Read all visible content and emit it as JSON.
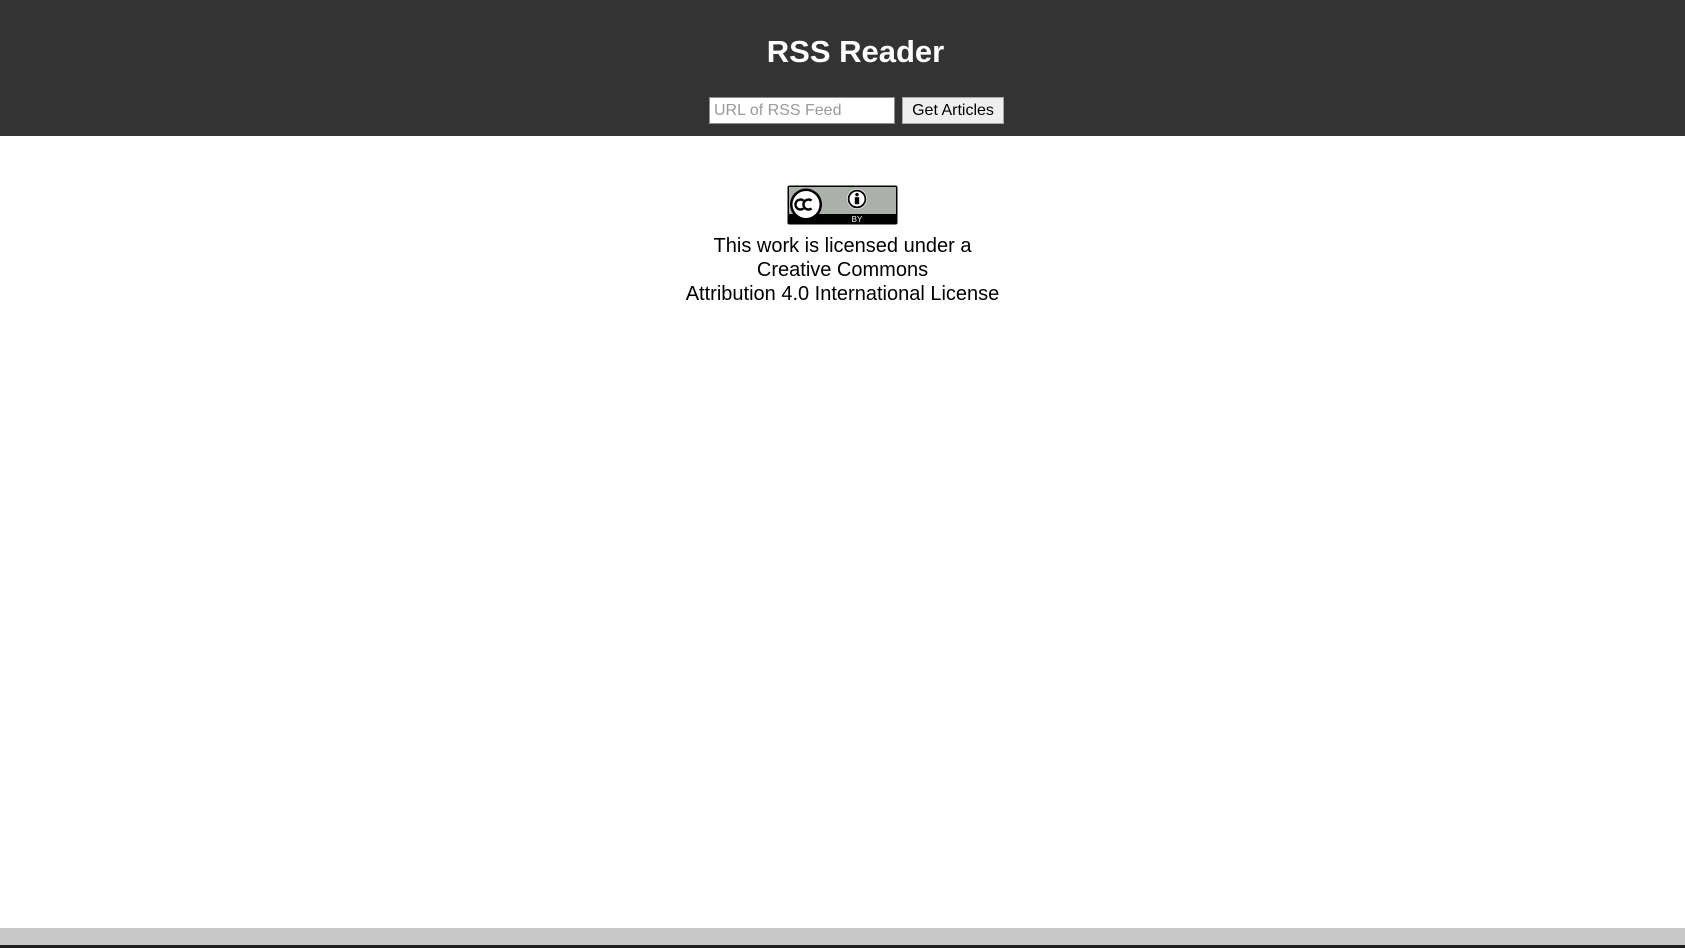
{
  "header": {
    "title": "RSS Reader",
    "feed_input": {
      "placeholder": "URL of RSS Feed",
      "value": ""
    },
    "get_articles_label": "Get Articles"
  },
  "license": {
    "badge_icon": "creative-commons-by-icon",
    "badge_text": "BY",
    "line1": "This work is licensed under a",
    "line2": "Creative Commons",
    "line3": "Attribution 4.0 International License"
  },
  "colors": {
    "header_background": "#333333",
    "header_text": "#ffffff",
    "page_background": "#ffffff",
    "bottom_bar": "#c8c8c8"
  }
}
